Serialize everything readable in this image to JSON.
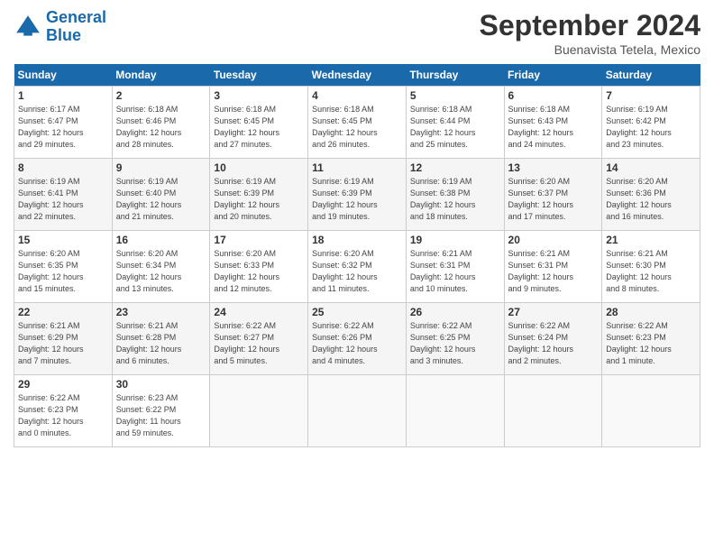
{
  "header": {
    "logo_line1": "General",
    "logo_line2": "Blue",
    "month": "September 2024",
    "location": "Buenavista Tetela, Mexico"
  },
  "weekdays": [
    "Sunday",
    "Monday",
    "Tuesday",
    "Wednesday",
    "Thursday",
    "Friday",
    "Saturday"
  ],
  "weeks": [
    [
      {
        "day": "1",
        "info": "Sunrise: 6:17 AM\nSunset: 6:47 PM\nDaylight: 12 hours\nand 29 minutes."
      },
      {
        "day": "2",
        "info": "Sunrise: 6:18 AM\nSunset: 6:46 PM\nDaylight: 12 hours\nand 28 minutes."
      },
      {
        "day": "3",
        "info": "Sunrise: 6:18 AM\nSunset: 6:45 PM\nDaylight: 12 hours\nand 27 minutes."
      },
      {
        "day": "4",
        "info": "Sunrise: 6:18 AM\nSunset: 6:45 PM\nDaylight: 12 hours\nand 26 minutes."
      },
      {
        "day": "5",
        "info": "Sunrise: 6:18 AM\nSunset: 6:44 PM\nDaylight: 12 hours\nand 25 minutes."
      },
      {
        "day": "6",
        "info": "Sunrise: 6:18 AM\nSunset: 6:43 PM\nDaylight: 12 hours\nand 24 minutes."
      },
      {
        "day": "7",
        "info": "Sunrise: 6:19 AM\nSunset: 6:42 PM\nDaylight: 12 hours\nand 23 minutes."
      }
    ],
    [
      {
        "day": "8",
        "info": "Sunrise: 6:19 AM\nSunset: 6:41 PM\nDaylight: 12 hours\nand 22 minutes."
      },
      {
        "day": "9",
        "info": "Sunrise: 6:19 AM\nSunset: 6:40 PM\nDaylight: 12 hours\nand 21 minutes."
      },
      {
        "day": "10",
        "info": "Sunrise: 6:19 AM\nSunset: 6:39 PM\nDaylight: 12 hours\nand 20 minutes."
      },
      {
        "day": "11",
        "info": "Sunrise: 6:19 AM\nSunset: 6:39 PM\nDaylight: 12 hours\nand 19 minutes."
      },
      {
        "day": "12",
        "info": "Sunrise: 6:19 AM\nSunset: 6:38 PM\nDaylight: 12 hours\nand 18 minutes."
      },
      {
        "day": "13",
        "info": "Sunrise: 6:20 AM\nSunset: 6:37 PM\nDaylight: 12 hours\nand 17 minutes."
      },
      {
        "day": "14",
        "info": "Sunrise: 6:20 AM\nSunset: 6:36 PM\nDaylight: 12 hours\nand 16 minutes."
      }
    ],
    [
      {
        "day": "15",
        "info": "Sunrise: 6:20 AM\nSunset: 6:35 PM\nDaylight: 12 hours\nand 15 minutes."
      },
      {
        "day": "16",
        "info": "Sunrise: 6:20 AM\nSunset: 6:34 PM\nDaylight: 12 hours\nand 13 minutes."
      },
      {
        "day": "17",
        "info": "Sunrise: 6:20 AM\nSunset: 6:33 PM\nDaylight: 12 hours\nand 12 minutes."
      },
      {
        "day": "18",
        "info": "Sunrise: 6:20 AM\nSunset: 6:32 PM\nDaylight: 12 hours\nand 11 minutes."
      },
      {
        "day": "19",
        "info": "Sunrise: 6:21 AM\nSunset: 6:31 PM\nDaylight: 12 hours\nand 10 minutes."
      },
      {
        "day": "20",
        "info": "Sunrise: 6:21 AM\nSunset: 6:31 PM\nDaylight: 12 hours\nand 9 minutes."
      },
      {
        "day": "21",
        "info": "Sunrise: 6:21 AM\nSunset: 6:30 PM\nDaylight: 12 hours\nand 8 minutes."
      }
    ],
    [
      {
        "day": "22",
        "info": "Sunrise: 6:21 AM\nSunset: 6:29 PM\nDaylight: 12 hours\nand 7 minutes."
      },
      {
        "day": "23",
        "info": "Sunrise: 6:21 AM\nSunset: 6:28 PM\nDaylight: 12 hours\nand 6 minutes."
      },
      {
        "day": "24",
        "info": "Sunrise: 6:22 AM\nSunset: 6:27 PM\nDaylight: 12 hours\nand 5 minutes."
      },
      {
        "day": "25",
        "info": "Sunrise: 6:22 AM\nSunset: 6:26 PM\nDaylight: 12 hours\nand 4 minutes."
      },
      {
        "day": "26",
        "info": "Sunrise: 6:22 AM\nSunset: 6:25 PM\nDaylight: 12 hours\nand 3 minutes."
      },
      {
        "day": "27",
        "info": "Sunrise: 6:22 AM\nSunset: 6:24 PM\nDaylight: 12 hours\nand 2 minutes."
      },
      {
        "day": "28",
        "info": "Sunrise: 6:22 AM\nSunset: 6:23 PM\nDaylight: 12 hours\nand 1 minute."
      }
    ],
    [
      {
        "day": "29",
        "info": "Sunrise: 6:22 AM\nSunset: 6:23 PM\nDaylight: 12 hours\nand 0 minutes."
      },
      {
        "day": "30",
        "info": "Sunrise: 6:23 AM\nSunset: 6:22 PM\nDaylight: 11 hours\nand 59 minutes."
      },
      {
        "day": "",
        "info": ""
      },
      {
        "day": "",
        "info": ""
      },
      {
        "day": "",
        "info": ""
      },
      {
        "day": "",
        "info": ""
      },
      {
        "day": "",
        "info": ""
      }
    ]
  ]
}
